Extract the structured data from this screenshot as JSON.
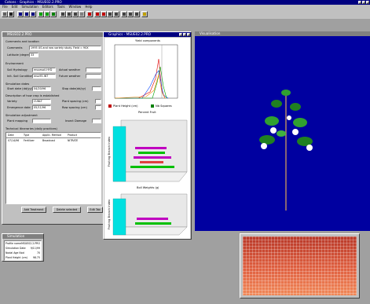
{
  "app": {
    "title": "Cotons - Graphics - MSUE02.2.PRO"
  },
  "menu": [
    "File",
    "Edit",
    "Simulation",
    "Editors",
    "Tools",
    "Window",
    "Help"
  ],
  "left_window": {
    "title": "MSUE02.2.PRO",
    "sections": {
      "general": "Comments and location",
      "environment": "Environment",
      "dates": "Simulation dates",
      "description": "Description of how crop is established",
      "adjustment": "Simulation adjustment",
      "treatments": "Technical Itineraries (daily practices)"
    },
    "labels": {
      "comments": "Comments",
      "latitude": "Latitude (degree)",
      "soil_hydrology": "Soil Hydrology",
      "init_soil": "Init. Soil Conditions",
      "actual_weather": "Actual weather",
      "future_weather": "Future weather",
      "start_date": "Start date (dd/yy)",
      "stop_date": "Stop date(dd/yy)",
      "variety": "Variety",
      "plant_spacing": "Plant spacing (cm)",
      "emergence": "Emergence date",
      "row_spacing": "Row spacing (cm)",
      "plant_mapping": "Plant mapping",
      "insect_damage": "Insect Damage"
    },
    "values": {
      "comments": "1995 US and row variety study. Field = 90X",
      "latitude": "33",
      "soil_hydrology": "msuesoil.HYD",
      "init_soil": "msu95.INT",
      "start_date": "04/20/96",
      "variety": "CUNLT",
      "emergence": "05/11/96"
    },
    "table": {
      "headers": [
        "Date",
        "Type",
        "Applic. Method",
        "Product"
      ],
      "rows": [
        [
          "07/14/96",
          "Fertilizer",
          "Broadcast",
          "NITRATE"
        ]
      ]
    },
    "buttons": {
      "add": "Add Treatment",
      "delete": "Delete selected",
      "edit": "Edit Tab"
    }
  },
  "graphics_window": {
    "title": "Graphics - MSUE02.2.PRO",
    "chart1": {
      "title": "Yield components",
      "legend": [
        "Plant Height (cm)",
        "Nb Squares"
      ]
    },
    "chart2": {
      "title": "Percent Fruit",
      "ylabel": "Fruiting Branch Index"
    },
    "chart3": {
      "title": "Boll Weights (g)",
      "ylabel": "Fruiting Branch Index"
    }
  },
  "visualisation": {
    "title": "Visualisation"
  },
  "simulation_window": {
    "title": "Simulation",
    "rows": [
      {
        "label": "Profile name",
        "value": "MSUE02.2.PRO"
      },
      {
        "label": "Simulation Date",
        "value": "9/11/99"
      },
      {
        "label": "Nodal Age Nod",
        "value": "70"
      },
      {
        "label": "Plant Height (cm)",
        "value": "98.75"
      }
    ]
  },
  "colors": {
    "title_active": "#000080",
    "viz_bg": "#0000a0",
    "heatmap": "#d05040"
  }
}
